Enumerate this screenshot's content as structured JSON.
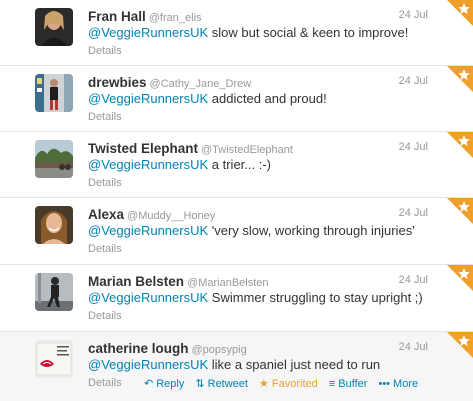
{
  "tweets": [
    {
      "name": "Fran Hall",
      "handle": "@fran_elis",
      "time": "24 Jul",
      "mention": "@VeggieRunnersUK",
      "text": " slow but social & keen to improve!",
      "details": "Details"
    },
    {
      "name": "drewbies",
      "handle": "@Cathy_Jane_Drew",
      "time": "24 Jul",
      "mention": "@VeggieRunnersUK",
      "text": " addicted and proud!",
      "details": "Details"
    },
    {
      "name": "Twisted Elephant",
      "handle": "@TwistedElephant",
      "time": "24 Jul",
      "mention": "@VeggieRunnersUK",
      "text": " a trier... :-)",
      "details": "Details"
    },
    {
      "name": "Alexa",
      "handle": "@Muddy__Honey",
      "time": "24 Jul",
      "mention": "@VeggieRunnersUK",
      "text": " 'very slow, working through injuries'",
      "details": "Details"
    },
    {
      "name": "Marian Belsten",
      "handle": "@MarianBelsten",
      "time": "24 Jul",
      "mention": "@VeggieRunnersUK",
      "text": " Swimmer struggling to stay upright ;)",
      "details": "Details"
    },
    {
      "name": "catherine lough",
      "handle": "@popsypig",
      "time": "24 Jul",
      "mention": "@VeggieRunnersUK",
      "text": " like a spaniel  just need to run",
      "details": "Details"
    }
  ],
  "actions": {
    "reply_icon": "reply-icon",
    "reply": "Reply",
    "retweet_icon": "retweet-icon",
    "retweet": "Retweet",
    "favorite_icon": "star-icon",
    "favorited": "Favorited",
    "buffer_icon": "buffer-icon",
    "buffer": "Buffer",
    "more_icon": "dots-icon",
    "more": "More"
  },
  "colors": {
    "link": "#0084b4",
    "favorited": "#e5a52a",
    "corner": "#f0a028",
    "name": "#333333",
    "meta": "#999999"
  }
}
